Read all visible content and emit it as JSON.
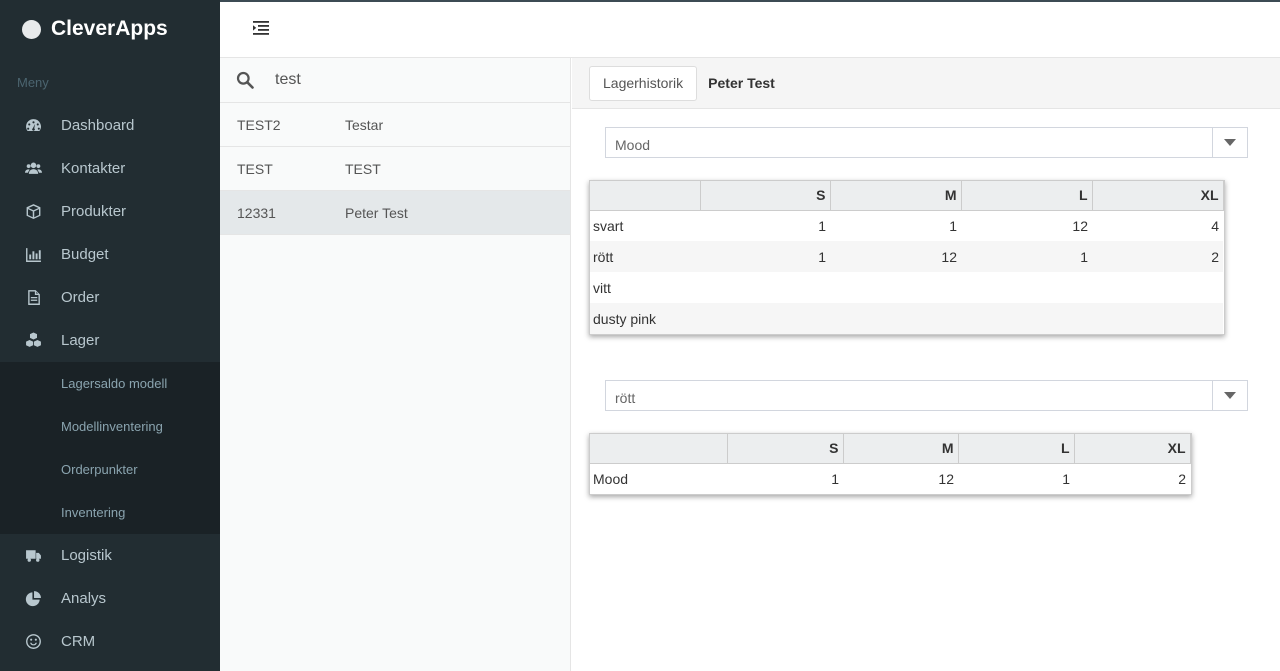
{
  "app": {
    "name": "CleverApps"
  },
  "sidebar": {
    "header": "Meny",
    "items": [
      {
        "label": "Dashboard",
        "icon": "dashboard-icon"
      },
      {
        "label": "Kontakter",
        "icon": "users-icon"
      },
      {
        "label": "Produkter",
        "icon": "cube-icon"
      },
      {
        "label": "Budget",
        "icon": "bar-chart-icon"
      },
      {
        "label": "Order",
        "icon": "file-icon"
      },
      {
        "label": "Lager",
        "icon": "cubes-icon"
      }
    ],
    "submenu": [
      {
        "label": "Lagersaldo modell"
      },
      {
        "label": "Modellinventering"
      },
      {
        "label": "Orderpunkter"
      },
      {
        "label": "Inventering"
      }
    ],
    "items_after": [
      {
        "label": "Logistik",
        "icon": "truck-icon"
      },
      {
        "label": "Analys",
        "icon": "pie-chart-icon"
      },
      {
        "label": "CRM",
        "icon": "smile-icon"
      }
    ]
  },
  "search": {
    "value": "test"
  },
  "list": [
    {
      "code": "TEST2",
      "name": "Testar"
    },
    {
      "code": "TEST",
      "name": "TEST"
    },
    {
      "code": "12331",
      "name": "Peter Test"
    }
  ],
  "detail": {
    "tab_label": "Lagerhistorik",
    "contact_name": "Peter Test",
    "select1": "Mood",
    "table1": {
      "columns": [
        "S",
        "M",
        "L",
        "XL"
      ],
      "rows": [
        {
          "label": "svart",
          "values": [
            "1",
            "1",
            "12",
            "4"
          ]
        },
        {
          "label": "rött",
          "values": [
            "1",
            "12",
            "1",
            "2"
          ]
        },
        {
          "label": "vitt",
          "values": [
            "",
            "",
            "",
            ""
          ]
        },
        {
          "label": "dusty pink",
          "values": [
            "",
            "",
            "",
            ""
          ]
        }
      ]
    },
    "select2": "rött",
    "table2": {
      "columns": [
        "S",
        "M",
        "L",
        "XL"
      ],
      "rows": [
        {
          "label": "Mood",
          "values": [
            "1",
            "12",
            "1",
            "2"
          ]
        }
      ]
    }
  }
}
